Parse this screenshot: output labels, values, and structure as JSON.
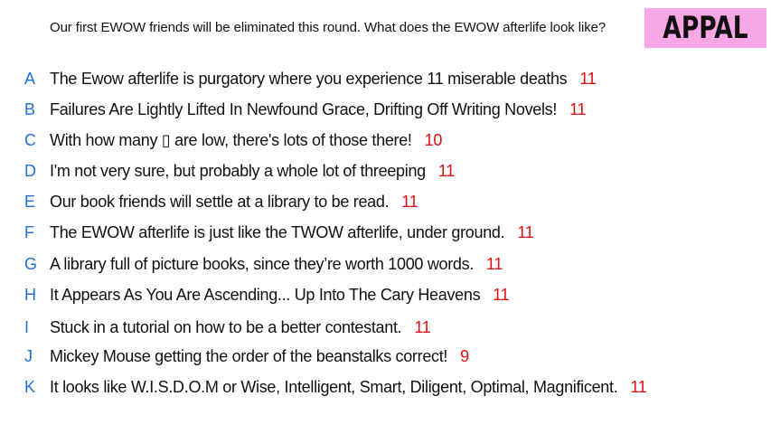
{
  "prompt": "Our first EWOW friends will be eliminated this round. What does the EWOW afterlife look like?",
  "badge": "APPAL",
  "colors": {
    "letter": "#1f6fd6",
    "count": "#e01010",
    "badge_bg": "#f7a6e6"
  },
  "responses": [
    {
      "letter": "A",
      "text": "The Ewow afterlife is purgatory where you experience 11 miserable deaths",
      "count": "11"
    },
    {
      "letter": "B",
      "text": "Failures Are Lightly Lifted In Newfound Grace, Drifting Off Writing Novels!",
      "count": "11"
    },
    {
      "letter": "C",
      "text": "With how many ▯ are low, there's lots of those there!",
      "count": "10"
    },
    {
      "letter": "D",
      "text": "I'm not very sure, but probably a whole lot of threeping",
      "count": "11"
    },
    {
      "letter": "E",
      "text": "Our book friends will settle at a library to be read.",
      "count": "11"
    },
    {
      "letter": "F",
      "text": "The EWOW afterlife is just like the TWOW afterlife, under ground.",
      "count": "11"
    },
    {
      "letter": "G",
      "text": "A library full of picture books, since they’re worth 1000 words.",
      "count": "11"
    },
    {
      "letter": "H",
      "text": "It Appears As You Are Ascending... Up Into The Cary Heavens",
      "count": "11"
    },
    {
      "letter": "I",
      "text": "Stuck in a tutorial on how to be a better contestant.",
      "count": "11"
    },
    {
      "letter": "J",
      "text": "Mickey Mouse getting the order of the beanstalks correct!",
      "count": "9"
    },
    {
      "letter": "K",
      "text": "It looks like W.I.S.D.O.M or Wise, Intelligent, Smart, Diligent, Optimal, Magnificent.",
      "count": "11"
    }
  ]
}
